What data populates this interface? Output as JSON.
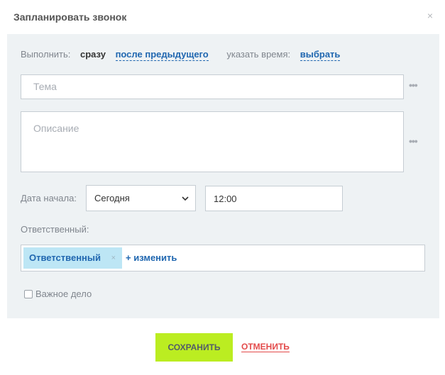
{
  "dialog": {
    "title": "Запланировать звонок",
    "close_glyph": "×"
  },
  "execute": {
    "label": "Выполнить:",
    "now": "сразу",
    "after_previous": "после предыдущего",
    "time_label": "указать время:",
    "choose": "выбрать"
  },
  "subject": {
    "placeholder": "Тема"
  },
  "description": {
    "placeholder": "Описание"
  },
  "more_glyph": "•••",
  "start_date": {
    "label": "Дата начала:",
    "selected": "Сегодня",
    "time": "12:00"
  },
  "responsible": {
    "label": "Ответственный:",
    "tag": "Ответственный",
    "tag_remove_glyph": "×",
    "change": "+ изменить"
  },
  "important": {
    "label": "Важное дело",
    "checked": false
  },
  "footer": {
    "save": "СОХРАНИТЬ",
    "cancel": "ОТМЕНИТЬ"
  },
  "colors": {
    "accent_link": "#2067b0",
    "save_button": "#bbed21",
    "cancel_link": "#e34b4b",
    "panel_bg": "#eef2f4",
    "tag_bg": "#bde6f5"
  },
  "icons": {
    "close": "close-icon",
    "more": "more-dots-icon",
    "select_arrow": "chevron-down-icon",
    "tag_remove": "remove-tag-icon"
  }
}
